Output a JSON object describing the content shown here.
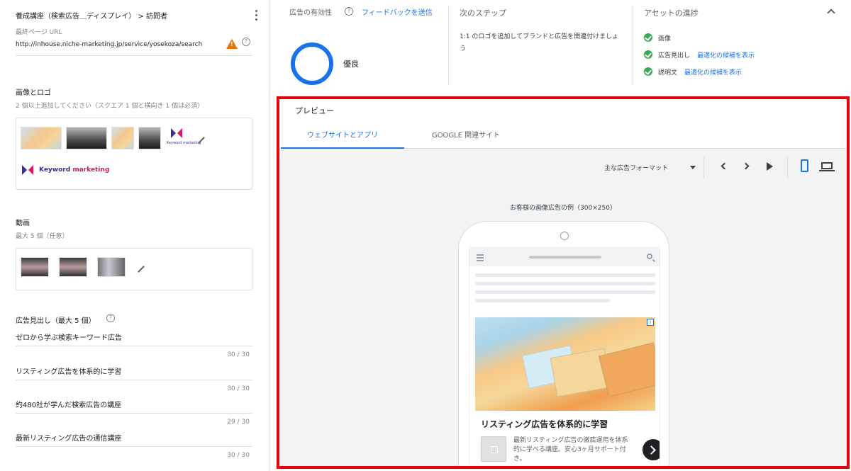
{
  "left": {
    "breadcrumb": "養成講座（検索広告＿ディスプレイ） > 訪問者",
    "final_url_label": "最終ページ URL",
    "final_url_value": "http://inhouse.niche-marketing.jp/service/yosekoza/search",
    "images_title": "画像とロゴ",
    "images_hint": "2 個以上追加してください（スクエア 1 個と横向き 1 個は必須）",
    "logo_small_text": "Keyword marketing",
    "logo_wide_prefix": "Keyword ",
    "logo_wide_suffix": "marketing",
    "video_title": "動画",
    "video_hint": "最大 5 個（任意）",
    "headlines_title": "広告見出し（最大 5 個）",
    "headlines": [
      {
        "text": "ゼロから学ぶ検索キーワード広告",
        "count": "30 / 30"
      },
      {
        "text": "リスティング広告を体系的に学習",
        "count": "30 / 30"
      },
      {
        "text": "約480社が学んだ検索広告の講座",
        "count": "29 / 30"
      },
      {
        "text": "最新リスティング広告の通信講座",
        "count": "30 / 30"
      }
    ]
  },
  "top": {
    "effectiveness_title": "広告の有効性",
    "feedback_link": "フィードバックを送信",
    "rating": "優良",
    "next_steps_title": "次のステップ",
    "next_steps_text": "1:1 のロゴを追加してブランドと広告を関連付けましょう",
    "asset_progress_title": "アセットの進捗",
    "assets": [
      {
        "label": "画像",
        "link": ""
      },
      {
        "label": "広告見出し",
        "link": "最適化の候補を表示"
      },
      {
        "label": "説明文",
        "link": "最適化の候補を表示"
      }
    ]
  },
  "preview": {
    "title": "プレビュー",
    "tabs": [
      "ウェブサイトとアプリ",
      "GOOGLE 関連サイト"
    ],
    "format_label": "主な広告フォーマット",
    "example_label": "お客様の画像広告の例（300×250）",
    "ad_headline": "リスティング広告を体系的に学習",
    "ad_description": "最新リスティング広告の徹底運用を体系的に学べる講座。安心3ヶ月サポート付き。"
  },
  "colors": {
    "accent": "#1a73e8",
    "highlight_border": "#e8000b",
    "success": "#34a853",
    "warning": "#e37400"
  },
  "icons": [
    "more-vert-icon",
    "help-icon",
    "warning-icon",
    "edit-icon",
    "check-circle-icon",
    "chevron-up-icon",
    "dropdown-icon",
    "chevron-left-icon",
    "chevron-right-icon",
    "play-icon",
    "phone-icon",
    "laptop-icon",
    "menu-icon",
    "search-icon",
    "ad-info-icon"
  ]
}
